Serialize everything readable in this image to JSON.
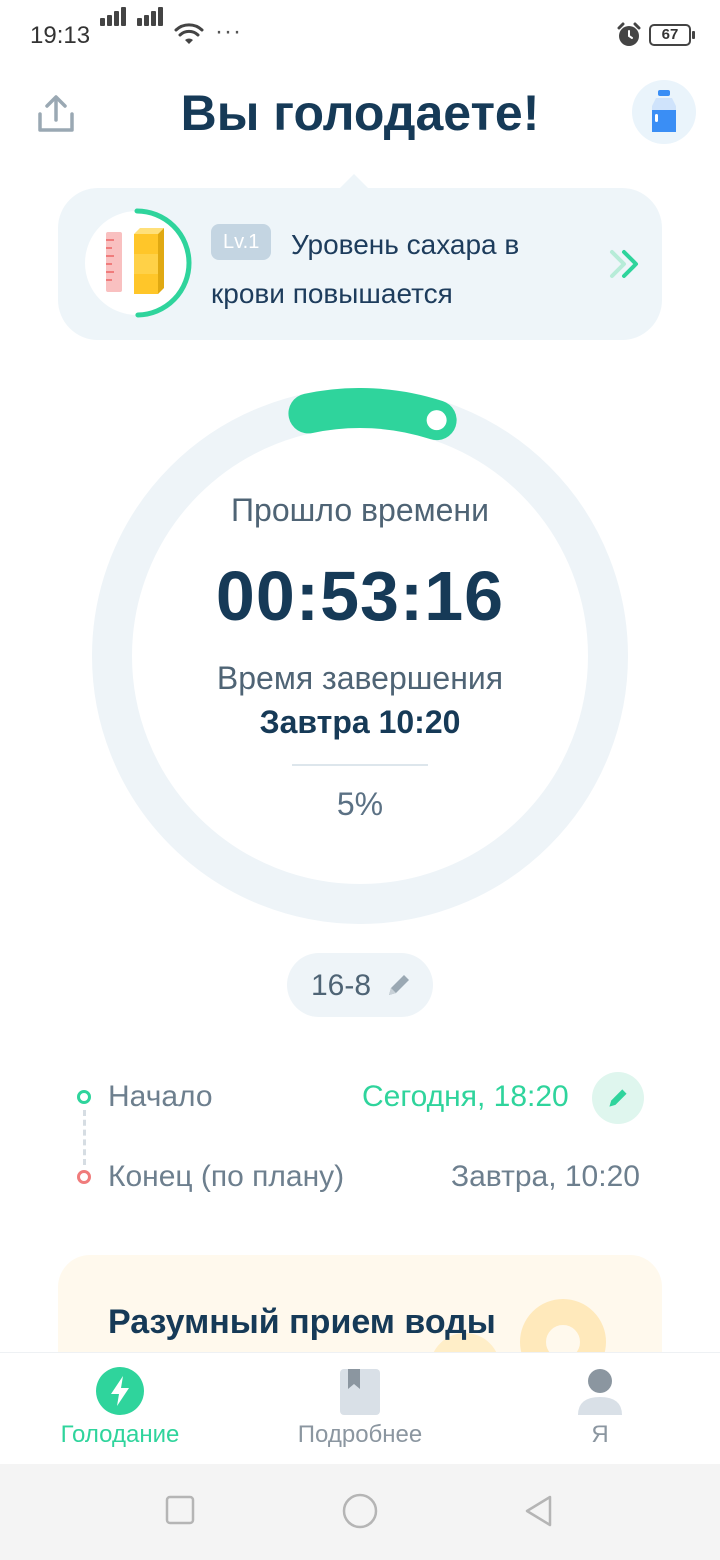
{
  "status_bar": {
    "time": "19:13",
    "dots": "···",
    "battery": "67"
  },
  "header": {
    "title": "Вы голодаете!",
    "share_icon": "share-icon",
    "water_icon": "water-bottle-icon"
  },
  "level_card": {
    "badge": "Lv.1",
    "text": "Уровень сахара в крови повышается",
    "progress": 0.5,
    "colors": {
      "accent": "#2fd49c",
      "cube": "#ffc629",
      "ruler": "#f9a3a3"
    }
  },
  "timer": {
    "elapsed_label": "Прошло времени",
    "elapsed_value": "00:53:16",
    "end_label": "Время завершения",
    "end_value": "Завтра 10:20",
    "percent_label": "5%",
    "progress": 0.05,
    "colors": {
      "track": "#eef4f8",
      "progress": "#2fd49c"
    }
  },
  "plan": {
    "label": "16-8"
  },
  "schedule": {
    "start_label": "Начало",
    "start_value": "Сегодня, 18:20",
    "end_label": "Конец (по плану)",
    "end_value": "Завтра, 10:20",
    "colors": {
      "start": "#2fd49c",
      "end": "#f07c7c",
      "end_value": "#6d7f8e"
    }
  },
  "water_card": {
    "title": "Разумный прием воды"
  },
  "bottom_nav": {
    "items": [
      {
        "label": "Голодание",
        "icon": "lightning-icon",
        "active": true
      },
      {
        "label": "Подробнее",
        "icon": "bookmark-book-icon",
        "active": false
      },
      {
        "label": "Я",
        "icon": "user-icon",
        "active": false
      }
    ],
    "colors": {
      "active": "#2fd49c",
      "inactive": "#8b96a0"
    }
  },
  "system_nav": {
    "icons": [
      "recent-apps-icon",
      "home-icon",
      "back-icon"
    ]
  }
}
